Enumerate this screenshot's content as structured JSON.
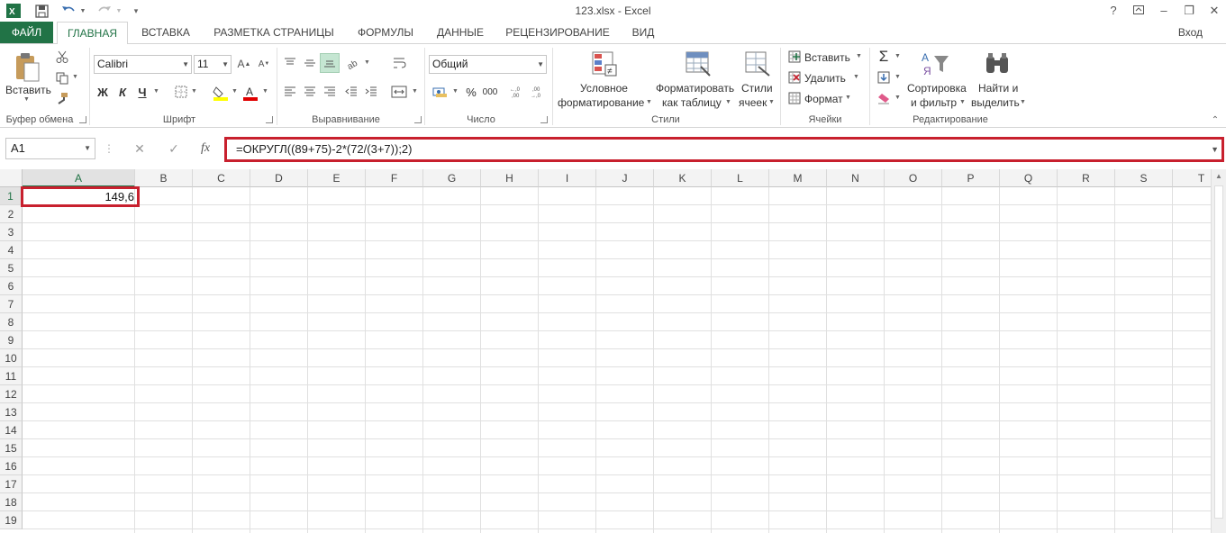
{
  "window": {
    "title": "123.xlsx - Excel",
    "help": "?",
    "minimize": "–",
    "close": "✕",
    "restore": "❐"
  },
  "tabs": {
    "file": "ФАЙЛ",
    "home": "ГЛАВНАЯ",
    "insert": "ВСТАВКА",
    "page_layout": "РАЗМЕТКА СТРАНИЦЫ",
    "formulas": "ФОРМУЛЫ",
    "data": "ДАННЫЕ",
    "review": "РЕЦЕНЗИРОВАНИЕ",
    "view": "ВИД",
    "login": "Вход"
  },
  "ribbon": {
    "clipboard": {
      "paste": "Вставить",
      "label": "Буфер обмена"
    },
    "font": {
      "name": "Calibri",
      "size": "11",
      "bold": "Ж",
      "italic": "К",
      "underline": "Ч",
      "label": "Шрифт"
    },
    "alignment": {
      "label": "Выравнивание"
    },
    "number": {
      "format": "Общий",
      "percent": "%",
      "thousands": "000",
      "label": "Число"
    },
    "styles": {
      "conditional_1": "Условное",
      "conditional_2": "форматирование",
      "table_1": "Форматировать",
      "table_2": "как таблицу",
      "cell_1": "Стили",
      "cell_2": "ячеек",
      "label": "Стили"
    },
    "cells": {
      "insert": "Вставить",
      "delete": "Удалить",
      "format": "Формат",
      "label": "Ячейки"
    },
    "editing": {
      "sort_1": "Сортировка",
      "sort_2": "и фильтр",
      "find_1": "Найти и",
      "find_2": "выделить",
      "label": "Редактирование"
    }
  },
  "formula_bar": {
    "name_box": "A1",
    "fx": "fx",
    "formula": "=ОКРУГЛ((89+75)-2*(72/(3+7));2)"
  },
  "grid": {
    "columns": [
      "A",
      "B",
      "C",
      "D",
      "E",
      "F",
      "G",
      "H",
      "I",
      "J",
      "K",
      "L",
      "M",
      "N",
      "O",
      "P",
      "Q",
      "R",
      "S",
      "T"
    ],
    "rows": [
      "1",
      "2",
      "3",
      "4",
      "5",
      "6",
      "7",
      "8",
      "9",
      "10",
      "11",
      "12",
      "13",
      "14",
      "15",
      "16",
      "17",
      "18",
      "19"
    ],
    "cell_a1": "149,6"
  },
  "colors": {
    "accent": "#217346",
    "highlight": "#c8202e"
  }
}
